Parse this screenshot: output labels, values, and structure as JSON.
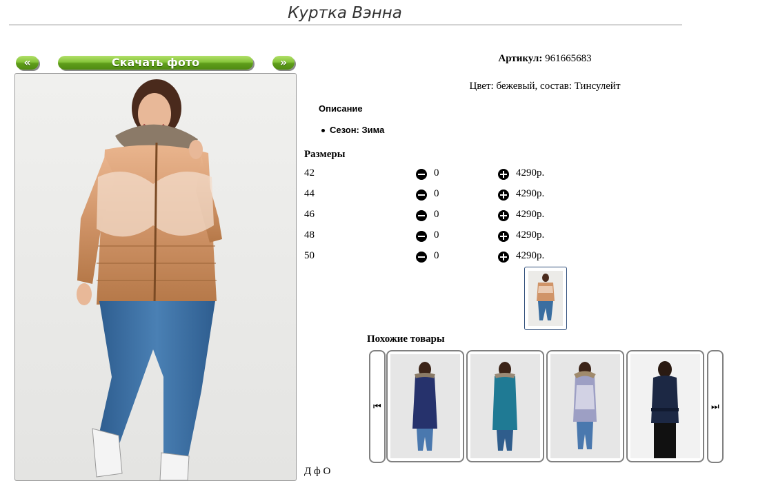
{
  "product": {
    "title": "Куртка Вэнна",
    "article_label": "Артикул:",
    "article_value": "961665683",
    "color_composition": "Цвет: бежевый, состав: Тинсулейт",
    "description_heading": "Описание",
    "description_items": [
      "Сезон: Зима"
    ]
  },
  "photo_nav": {
    "prev_label": "«",
    "download_label": "Скачать фото",
    "next_label": "»"
  },
  "sizes": {
    "heading": "Размеры",
    "rows": [
      {
        "size": "42",
        "qty": "0",
        "price": "4290р."
      },
      {
        "size": "44",
        "qty": "0",
        "price": "4290р."
      },
      {
        "size": "46",
        "qty": "0",
        "price": "4290р."
      },
      {
        "size": "48",
        "qty": "0",
        "price": "4290р."
      },
      {
        "size": "50",
        "qty": "0",
        "price": "4290р."
      }
    ]
  },
  "similar": {
    "heading": "Похожие товары",
    "prev_icon": "skip-back-icon",
    "next_icon": "skip-forward-icon"
  },
  "colors": {
    "button_green": "#6fae27",
    "jacket": "#c98b5f",
    "jeans": "#3a6ea0"
  },
  "footer_text": "Д                          ф                          О"
}
